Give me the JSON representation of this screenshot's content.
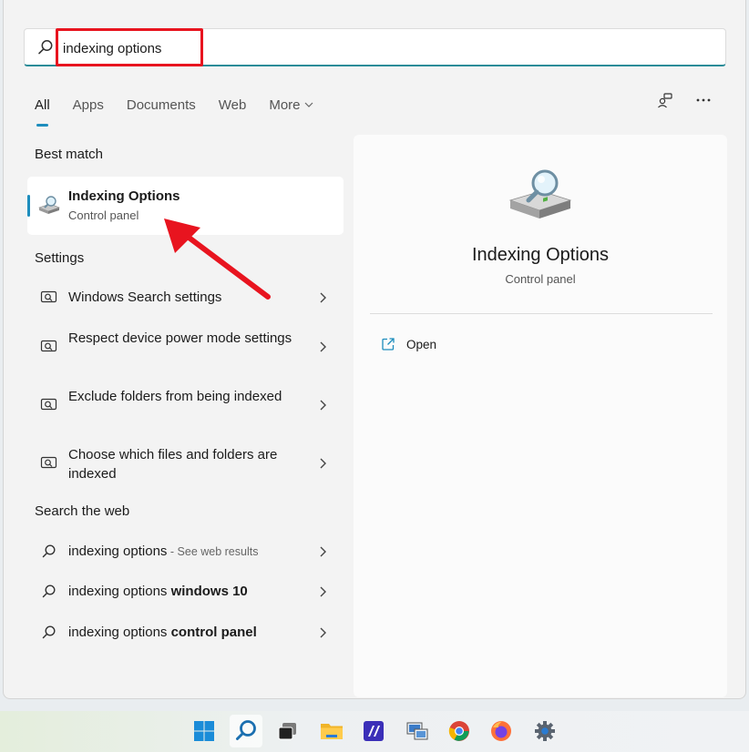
{
  "search": {
    "value": "indexing options"
  },
  "tabs": [
    {
      "label": "All"
    },
    {
      "label": "Apps"
    },
    {
      "label": "Documents"
    },
    {
      "label": "Web"
    },
    {
      "label": "More"
    }
  ],
  "sections": {
    "best_match": "Best match",
    "settings": "Settings",
    "web": "Search the web"
  },
  "best_match": {
    "title": "Indexing Options",
    "subtitle": "Control panel"
  },
  "settings_items": [
    {
      "label": "Windows Search settings"
    },
    {
      "label": "Respect device power mode settings"
    },
    {
      "label": "Exclude folders from being indexed"
    },
    {
      "label": "Choose which files and folders are indexed"
    }
  ],
  "web_items": [
    {
      "prefix": "indexing options",
      "suffix_muted": " - See web results"
    },
    {
      "prefix": "indexing options ",
      "bold": "windows 10"
    },
    {
      "prefix": "indexing options ",
      "bold": "control panel"
    }
  ],
  "preview": {
    "title": "Indexing Options",
    "subtitle": "Control panel",
    "action_open": "Open"
  },
  "taskbar_icons": [
    "windows-start-icon",
    "search-icon",
    "task-view-icon",
    "file-explorer-icon",
    "visual-studio-icon",
    "remote-desktop-icon",
    "chrome-icon",
    "firefox-icon",
    "settings-gear-icon"
  ],
  "colors": {
    "accent": "#1d8dbd",
    "search_underline": "#2b8c98",
    "annotation_red": "#e8141f"
  }
}
